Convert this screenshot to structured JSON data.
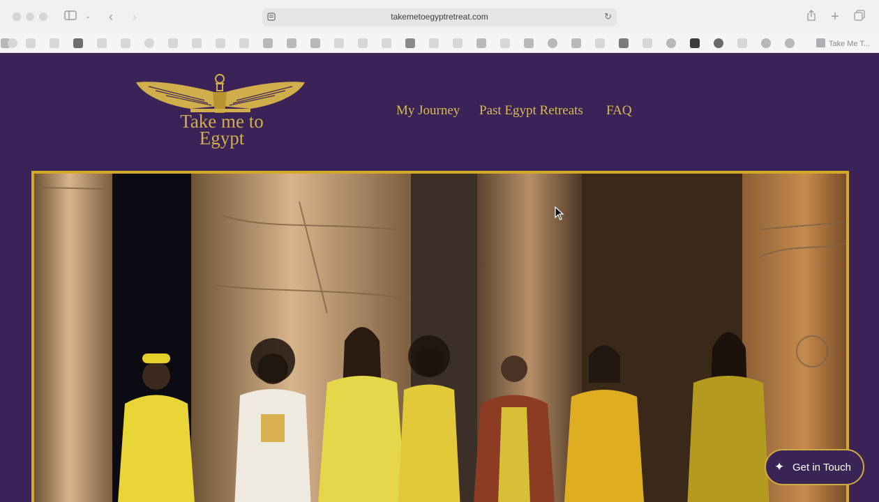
{
  "browser": {
    "url": "takemetoegyptretreat.com",
    "favorites_tab_label": "Take Me T..."
  },
  "site": {
    "logo_text_line1": "Take me to",
    "logo_text_line2": "Egypt",
    "nav": [
      {
        "label": "My Journey"
      },
      {
        "label": "Past Egypt Retreats"
      },
      {
        "label": "FAQ"
      }
    ],
    "cta_label": "Get in Touch"
  },
  "colors": {
    "background": "#3b2257",
    "gold": "#d2aa25",
    "nav_text": "#d8bb52"
  }
}
